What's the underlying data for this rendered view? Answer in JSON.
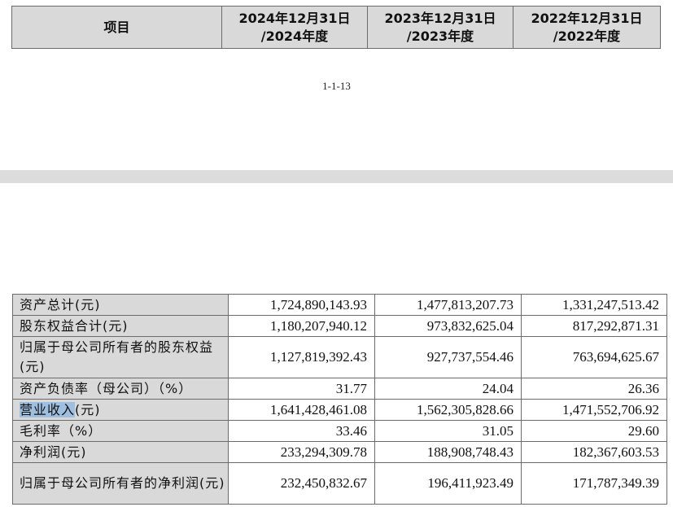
{
  "top_table": {
    "item_header": "项目",
    "years": [
      {
        "line1": "2024年12月31日",
        "line2": "/2024年度"
      },
      {
        "line1": "2023年12月31日",
        "line2": "/2023年度"
      },
      {
        "line1": "2022年12月31日",
        "line2": "/2022年度"
      }
    ]
  },
  "page_number": "1-1-13",
  "financial_table": {
    "rows": [
      {
        "label": "资产总计(元)",
        "values": [
          "1,724,890,143.93",
          "1,477,813,207.73",
          "1,331,247,513.42"
        ]
      },
      {
        "label": "股东权益合计(元)",
        "values": [
          "1,180,207,940.12",
          "973,832,625.04",
          "817,292,871.31"
        ]
      },
      {
        "label": "归属于母公司所有者的股东权益(元)",
        "values": [
          "1,127,819,392.43",
          "927,737,554.46",
          "763,694,625.67"
        ]
      },
      {
        "label": "资产负债率（母公司）（%）",
        "values": [
          "31.77",
          "24.04",
          "26.36"
        ]
      },
      {
        "label_highlighted": "营业收入",
        "label_rest": "(元)",
        "values": [
          "1,641,428,461.08",
          "1,562,305,828.66",
          "1,471,552,706.92"
        ]
      },
      {
        "label": "毛利率（%）",
        "values": [
          "33.46",
          "31.05",
          "29.60"
        ]
      },
      {
        "label": "净利润(元)",
        "values": [
          "233,294,309.78",
          "188,908,748.43",
          "182,367,603.53"
        ]
      },
      {
        "label": "归属于母公司所有者的净利润(元)",
        "values": [
          "232,450,832.67",
          "196,411,923.49",
          "171,787,349.39"
        ]
      }
    ]
  }
}
